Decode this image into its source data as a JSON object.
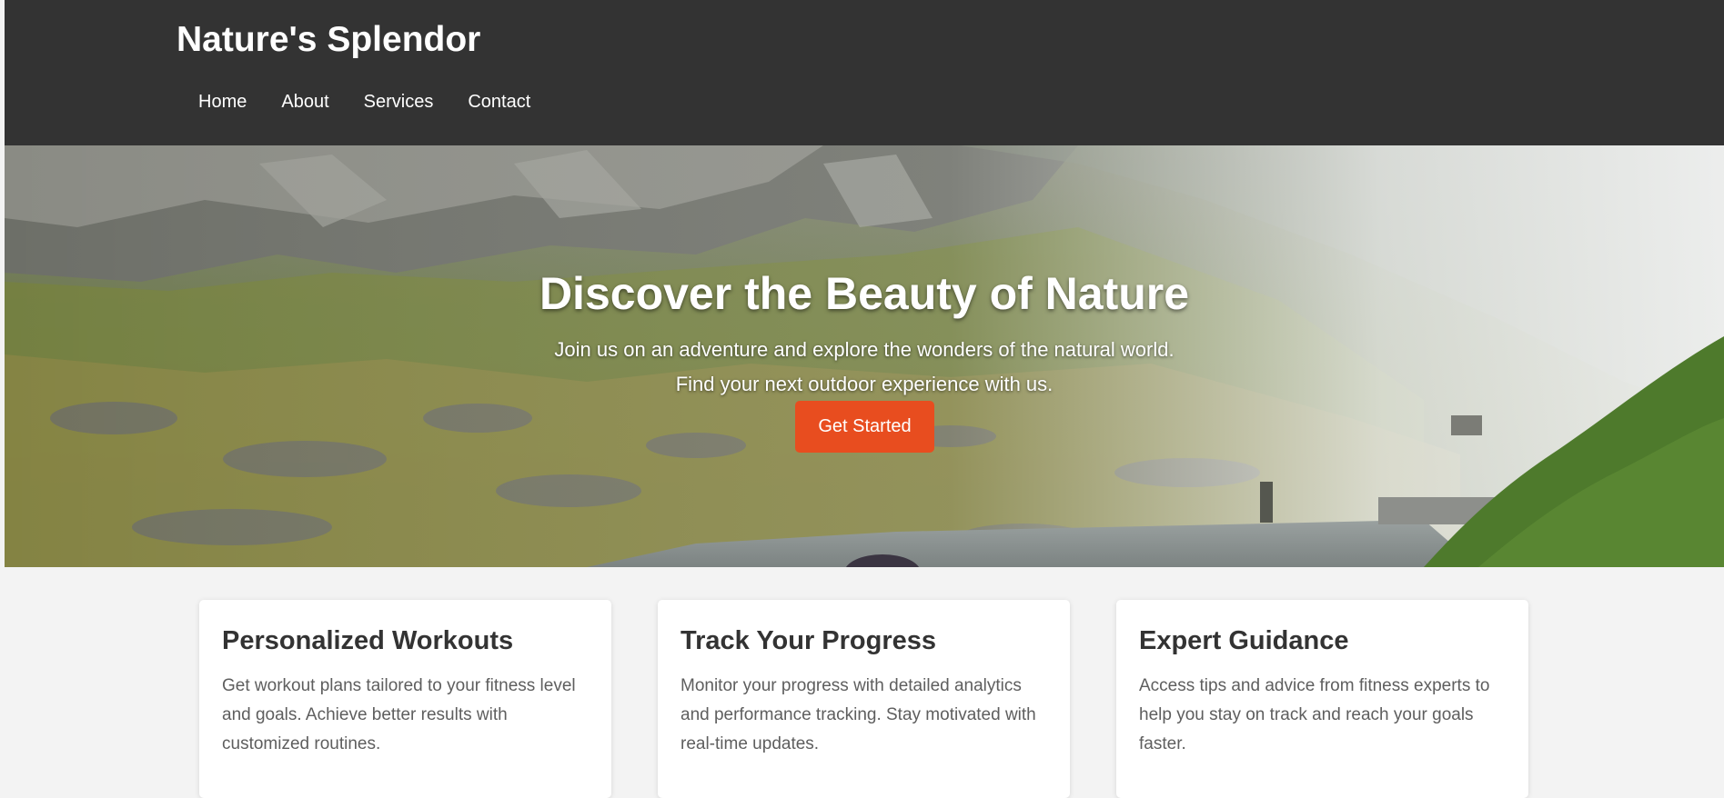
{
  "header": {
    "brand": "Nature's Splendor",
    "nav": [
      "Home",
      "About",
      "Services",
      "Contact"
    ]
  },
  "hero": {
    "title": "Discover the Beauty of Nature",
    "subtitle_lines": [
      "Join us on an adventure and explore the wonders of the natural world.",
      "Find your next outdoor experience with us."
    ],
    "cta_label": "Get Started"
  },
  "features": [
    {
      "title": "Personalized Workouts",
      "text": "Get workout plans tailored to your fitness level and goals. Achieve better results with customized routines."
    },
    {
      "title": "Track Your Progress",
      "text": "Monitor your progress with detailed analytics and performance tracking. Stay motivated with real-time updates."
    },
    {
      "title": "Expert Guidance",
      "text": "Access tips and advice from fitness experts to help you stay on track and reach your goals faster."
    }
  ],
  "colors": {
    "header_bg": "#333333",
    "accent": "#e84d1f",
    "page_bg": "#f3f3f3",
    "card_bg": "#ffffff",
    "heading_text": "#333333",
    "body_text": "#5e5e5e"
  }
}
